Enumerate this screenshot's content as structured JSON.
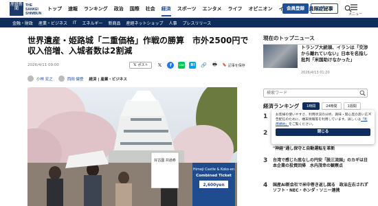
{
  "header": {
    "logo_kanji": "産経新聞",
    "logo_text": [
      "THE",
      "SANKEI",
      "SHIMBUN"
    ],
    "nav": [
      "トップ",
      "速報",
      "ランキング",
      "政治",
      "国際",
      "社会",
      "経済",
      "スポーツ",
      "エンタメ",
      "ライフ",
      "オピニオン",
      "イベント",
      "会員限定記事"
    ],
    "active_nav": "経済",
    "member_button": "会員登録",
    "login_button": "ログイン",
    "menu_label": "メニュー"
  },
  "subnav": [
    "金融・財政",
    "産業・ビジネス",
    "IT",
    "エネルギー",
    "新商品",
    "産経ネットショップ",
    "人事",
    "プレスリリース"
  ],
  "article": {
    "title": "世界遺産・姫路城「二重価格」作戦の勝算　市外2500円で収入倍増、入城者数は2割減",
    "date": "2026/4/11 09:00",
    "post_label": "ポスト",
    "save_label": "記事を保存",
    "authors": [
      "小林 宏之",
      "西岡 健登"
    ],
    "tags": "経済 | 産業・ビジネス",
    "photo_sign": {
      "title": "Himeji Castle & Koko-en",
      "subtitle": "Combined Ticket",
      "price": "2,600yen",
      "kanji_sign": "好古園 共通券"
    }
  },
  "sidebar": {
    "top_news_heading": "現在のトップニュース",
    "top_news_title": "トランプ大統領、イランは「交渉から離れていない」日本を名指し批判「米国助けなかった」",
    "top_news_date": "2026/4/13 01:20",
    "search_placeholder": "検索ワード",
    "ranking_heading": "経済ランキング",
    "ranking_tabs": [
      "1時間",
      "24時間",
      "1週間"
    ],
    "ranking_items": [
      {
        "num": "1",
        "text": "お"
      },
      {
        "num": "2",
        "text": "中"
      },
      {
        "num": "",
        "text": "\"神経\"通し保守と自動運転を革新"
      },
      {
        "num": "3",
        "text": "台湾で感じた底なしの円安「脱三流国」のカギは日本企業の投資回帰　水内茂幸の観察点"
      },
      {
        "num": "4",
        "text": "国産AI新会社で米中巻き返し図る　政治左右されず　ソフト・NEC・ホンダ・ソニー連携"
      }
    ]
  },
  "popup": {
    "text_before": "お客様の使いやすさ、利用状況の分析、興味・関心度の高い広告配信のために、端末情報等を利用しています。詳しくは",
    "link": "「利用規約」",
    "text_after": "をご覧ください。",
    "close_button": "閉じる"
  },
  "colors": {
    "brand_navy": "#0e2d5c",
    "accent_blue": "#1b4f9c"
  }
}
